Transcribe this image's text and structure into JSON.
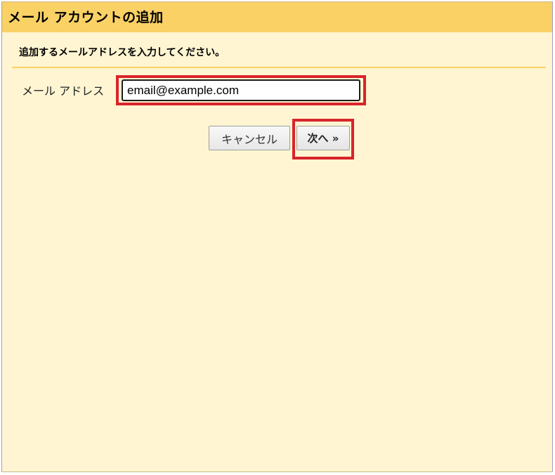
{
  "dialog": {
    "title": "メール アカウントの追加",
    "subtitle": "追加するメールアドレスを入力してください。"
  },
  "form": {
    "email_label": "メール アドレス",
    "email_value": "email@example.com"
  },
  "buttons": {
    "cancel_label": "キャンセル",
    "next_label": "次へ »"
  },
  "colors": {
    "title_bar": "#fad165",
    "panel_background": "#fff5d2",
    "highlight": "#d9242b"
  }
}
